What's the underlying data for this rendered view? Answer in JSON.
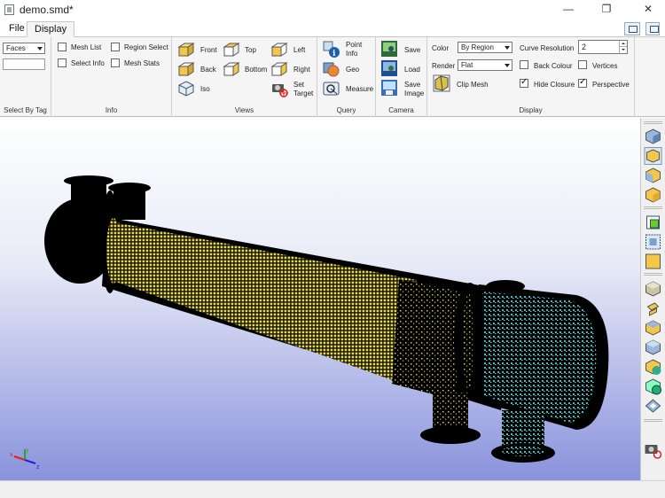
{
  "window": {
    "title": "demo.smd*",
    "minimize_glyph": "—",
    "restore_glyph": "❐",
    "close_glyph": "✕"
  },
  "menu": {
    "file": "File",
    "display": "Display"
  },
  "ribbon": {
    "select_by_tag": {
      "group_label": "Select By Tag",
      "dropdown_value": "Faces",
      "text_value": ""
    },
    "info": {
      "group_label": "Info",
      "mesh_list": "Mesh List",
      "region_select": "Region Select",
      "select_info": "Select Info",
      "mesh_stats": "Mesh Stats"
    },
    "views": {
      "group_label": "Views",
      "front": "Front",
      "top": "Top",
      "left": "Left",
      "back": "Back",
      "bottom": "Bottom",
      "right": "Right",
      "iso": "Iso",
      "set_target": "Set Target"
    },
    "query": {
      "group_label": "Query",
      "point_info": "Point Info",
      "geo": "Geo",
      "measure": "Measure"
    },
    "camera": {
      "group_label": "Camera",
      "save": "Save",
      "load": "Load",
      "save_image": "Save Image"
    },
    "display": {
      "group_label": "Display",
      "color_label": "Color",
      "color_value": "By Region",
      "render_label": "Render",
      "render_value": "Flat",
      "clip_mesh": "Clip Mesh",
      "curve_resolution_label": "Curve Resolution",
      "curve_resolution_value": "2",
      "back_colour": "Back Colour",
      "vertices": "Vertices",
      "hide_closure": "Hide Closure",
      "perspective": "Perspective",
      "hide_closure_checked": true,
      "perspective_checked": true
    }
  },
  "viewport": {
    "shell_color": "#e6d84a",
    "head_color": "#36c0c0",
    "body_color": "#000000",
    "axis_x": "x",
    "axis_y": "y",
    "axis_z": "z"
  },
  "right_toolbar": {
    "icons": [
      "view-iso-shaded-icon",
      "view-iso-wire-icon",
      "view-iso-yellow-icon",
      "view-iso-alt-icon",
      "fit-all-icon",
      "zoom-region-icon",
      "face-view-icon",
      "cube-solid-icon",
      "cube-slice-icon",
      "cube-yellow-icon",
      "cube-blue-icon",
      "cube-green-icon",
      "cube-select-icon",
      "cube-pointer-icon",
      "screenshot-icon"
    ]
  }
}
